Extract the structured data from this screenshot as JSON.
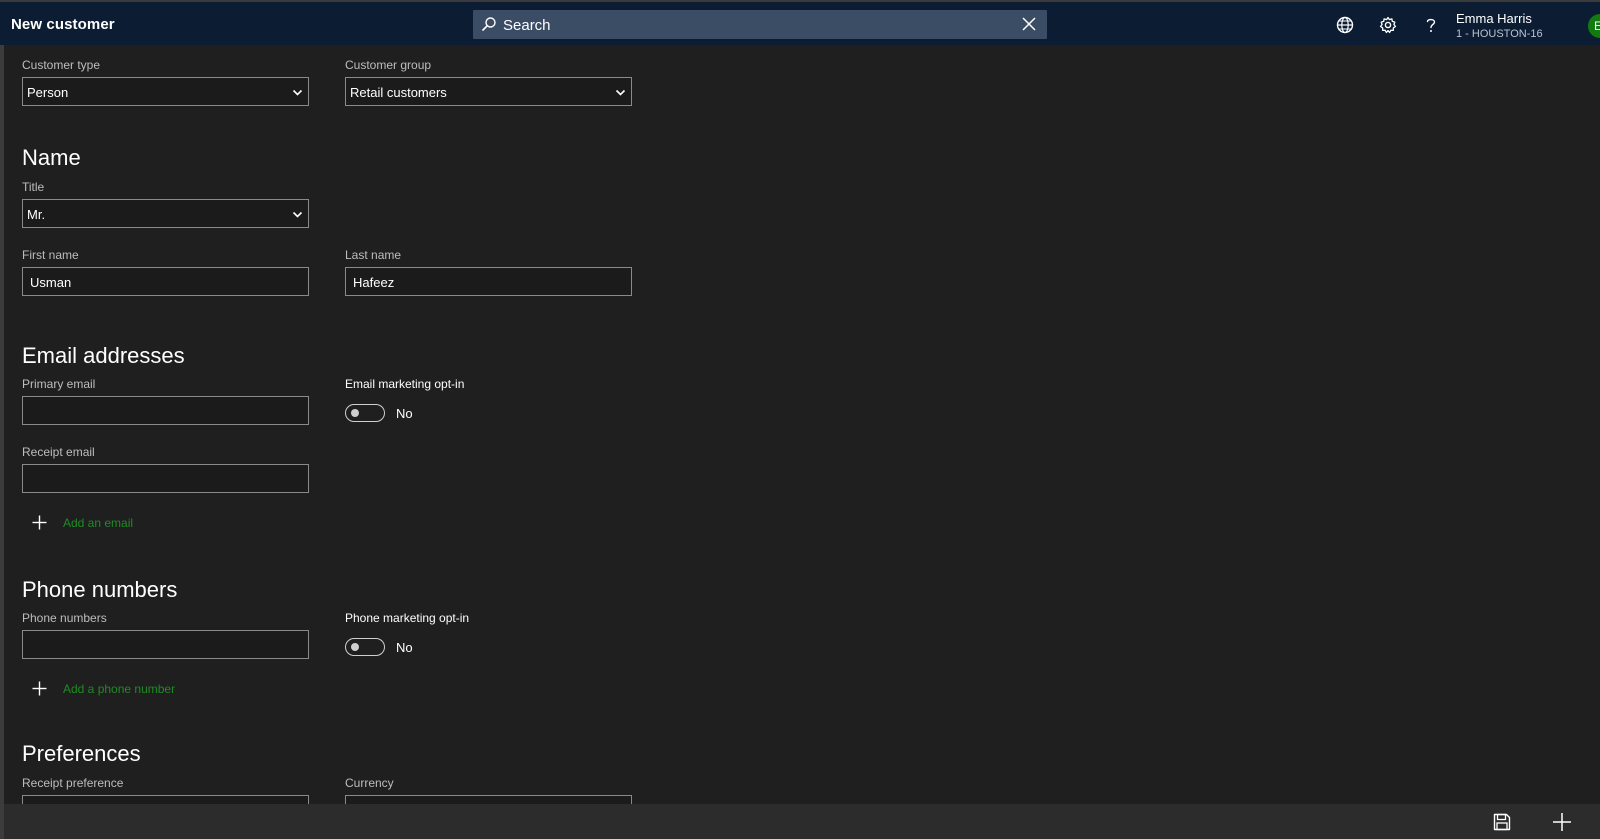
{
  "app": {
    "title": "New customer"
  },
  "search": {
    "placeholder": "Search"
  },
  "user": {
    "name": "Emma Harris",
    "store": "1 - HOUSTON-16",
    "initial": "E"
  },
  "icons": {
    "search": "search-icon",
    "close": "close-icon",
    "globe": "globe-icon",
    "settings": "gear-icon",
    "help": "help-icon",
    "chevron": "chevron-down-icon",
    "plus": "plus-icon",
    "save": "save-icon"
  },
  "colors": {
    "topbar": "#0c1d33",
    "background": "#1f1f1f",
    "link": "#1f8b24",
    "avatar": "#107c10"
  },
  "form": {
    "customer_type": {
      "label": "Customer type",
      "value": "Person"
    },
    "customer_group": {
      "label": "Customer group",
      "value": "Retail customers"
    },
    "name_section": {
      "title": "Name"
    },
    "title_field": {
      "label": "Title",
      "value": "Mr."
    },
    "first_name": {
      "label": "First name",
      "value": "Usman"
    },
    "last_name": {
      "label": "Last name",
      "value": "Hafeez"
    },
    "email_section": {
      "title": "Email addresses"
    },
    "primary_email": {
      "label": "Primary email",
      "value": ""
    },
    "email_optin": {
      "label": "Email marketing opt-in",
      "value": "No"
    },
    "receipt_email": {
      "label": "Receipt email",
      "value": ""
    },
    "add_email": {
      "label": "Add an email"
    },
    "phone_section": {
      "title": "Phone numbers"
    },
    "phone_numbers": {
      "label": "Phone numbers",
      "value": ""
    },
    "phone_optin": {
      "label": "Phone marketing opt-in",
      "value": "No"
    },
    "add_phone": {
      "label": "Add a phone number"
    },
    "preferences_section": {
      "title": "Preferences"
    },
    "receipt_preference": {
      "label": "Receipt preference"
    },
    "currency": {
      "label": "Currency"
    }
  }
}
